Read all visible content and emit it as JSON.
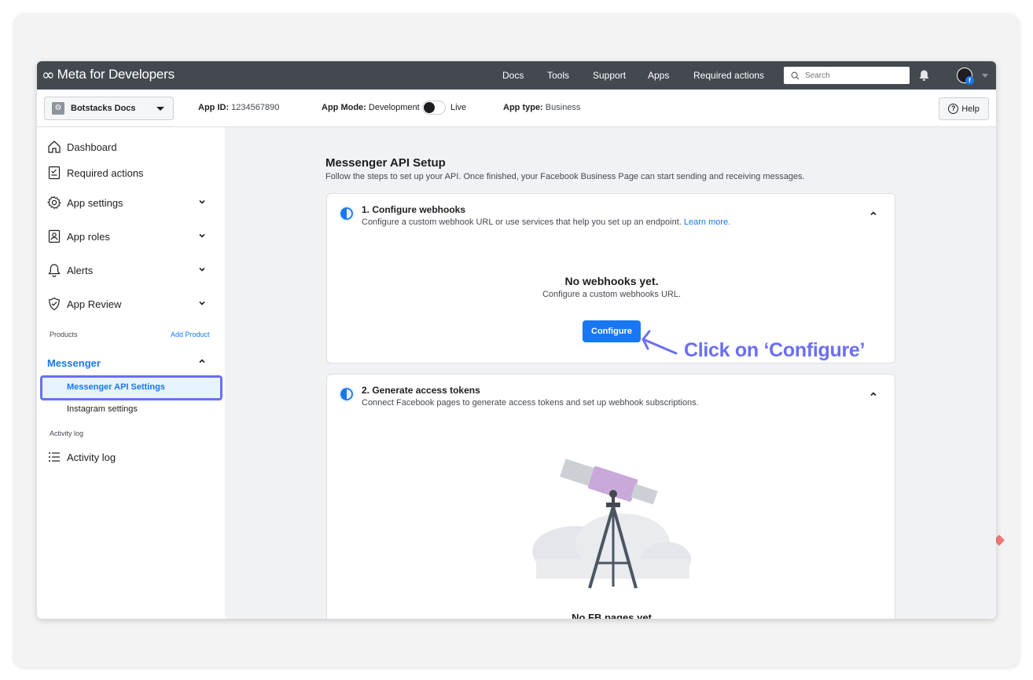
{
  "topnav": {
    "logo_mark": "∞",
    "logo_text": "Meta for Developers",
    "links": [
      "Docs",
      "Tools",
      "Support",
      "Apps",
      "Required actions"
    ],
    "search_placeholder": "Search"
  },
  "appbar": {
    "app_name": "Botstacks Docs",
    "app_id_label": "App ID:",
    "app_id_value": "1234567890",
    "app_mode_label": "App Mode:",
    "app_mode_value": "Development",
    "live_label": "Live",
    "app_type_label": "App type:",
    "app_type_value": "Business",
    "help_label": "Help"
  },
  "sidebar": {
    "items": [
      {
        "label": "Dashboard"
      },
      {
        "label": "Required actions"
      },
      {
        "label": "App settings"
      },
      {
        "label": "App roles"
      },
      {
        "label": "Alerts"
      },
      {
        "label": "App Review"
      }
    ],
    "products_label": "Products",
    "add_product_label": "Add Product",
    "messenger_label": "Messenger",
    "messenger_sub": [
      "Messenger API Settings",
      "Instagram settings"
    ],
    "activity_section_label": "Activity log",
    "activity_item_label": "Activity log"
  },
  "main": {
    "title": "Messenger API Setup",
    "subtitle": "Follow the steps to set up your API. Once finished, your Facebook Business Page can start sending and receiving messages.",
    "cards": [
      {
        "title": "1. Configure webhooks",
        "desc": "Configure a custom webhook URL or use services that help you set up an endpoint.",
        "link": "Learn more.",
        "empty_title": "No webhooks yet.",
        "empty_sub": "Configure a custom webhooks URL.",
        "button": "Configure"
      },
      {
        "title": "2. Generate access tokens",
        "desc": "Connect Facebook pages to generate access tokens and set up webhook subscriptions.",
        "empty_title": "No FB pages yet"
      }
    ]
  },
  "annotation": {
    "text": "Click on ‘Configure’",
    "color": "#6b6ef5"
  },
  "colors": {
    "accent": "#1877f2",
    "nav_bg": "#444950",
    "highlight": "#6b6ef5"
  }
}
